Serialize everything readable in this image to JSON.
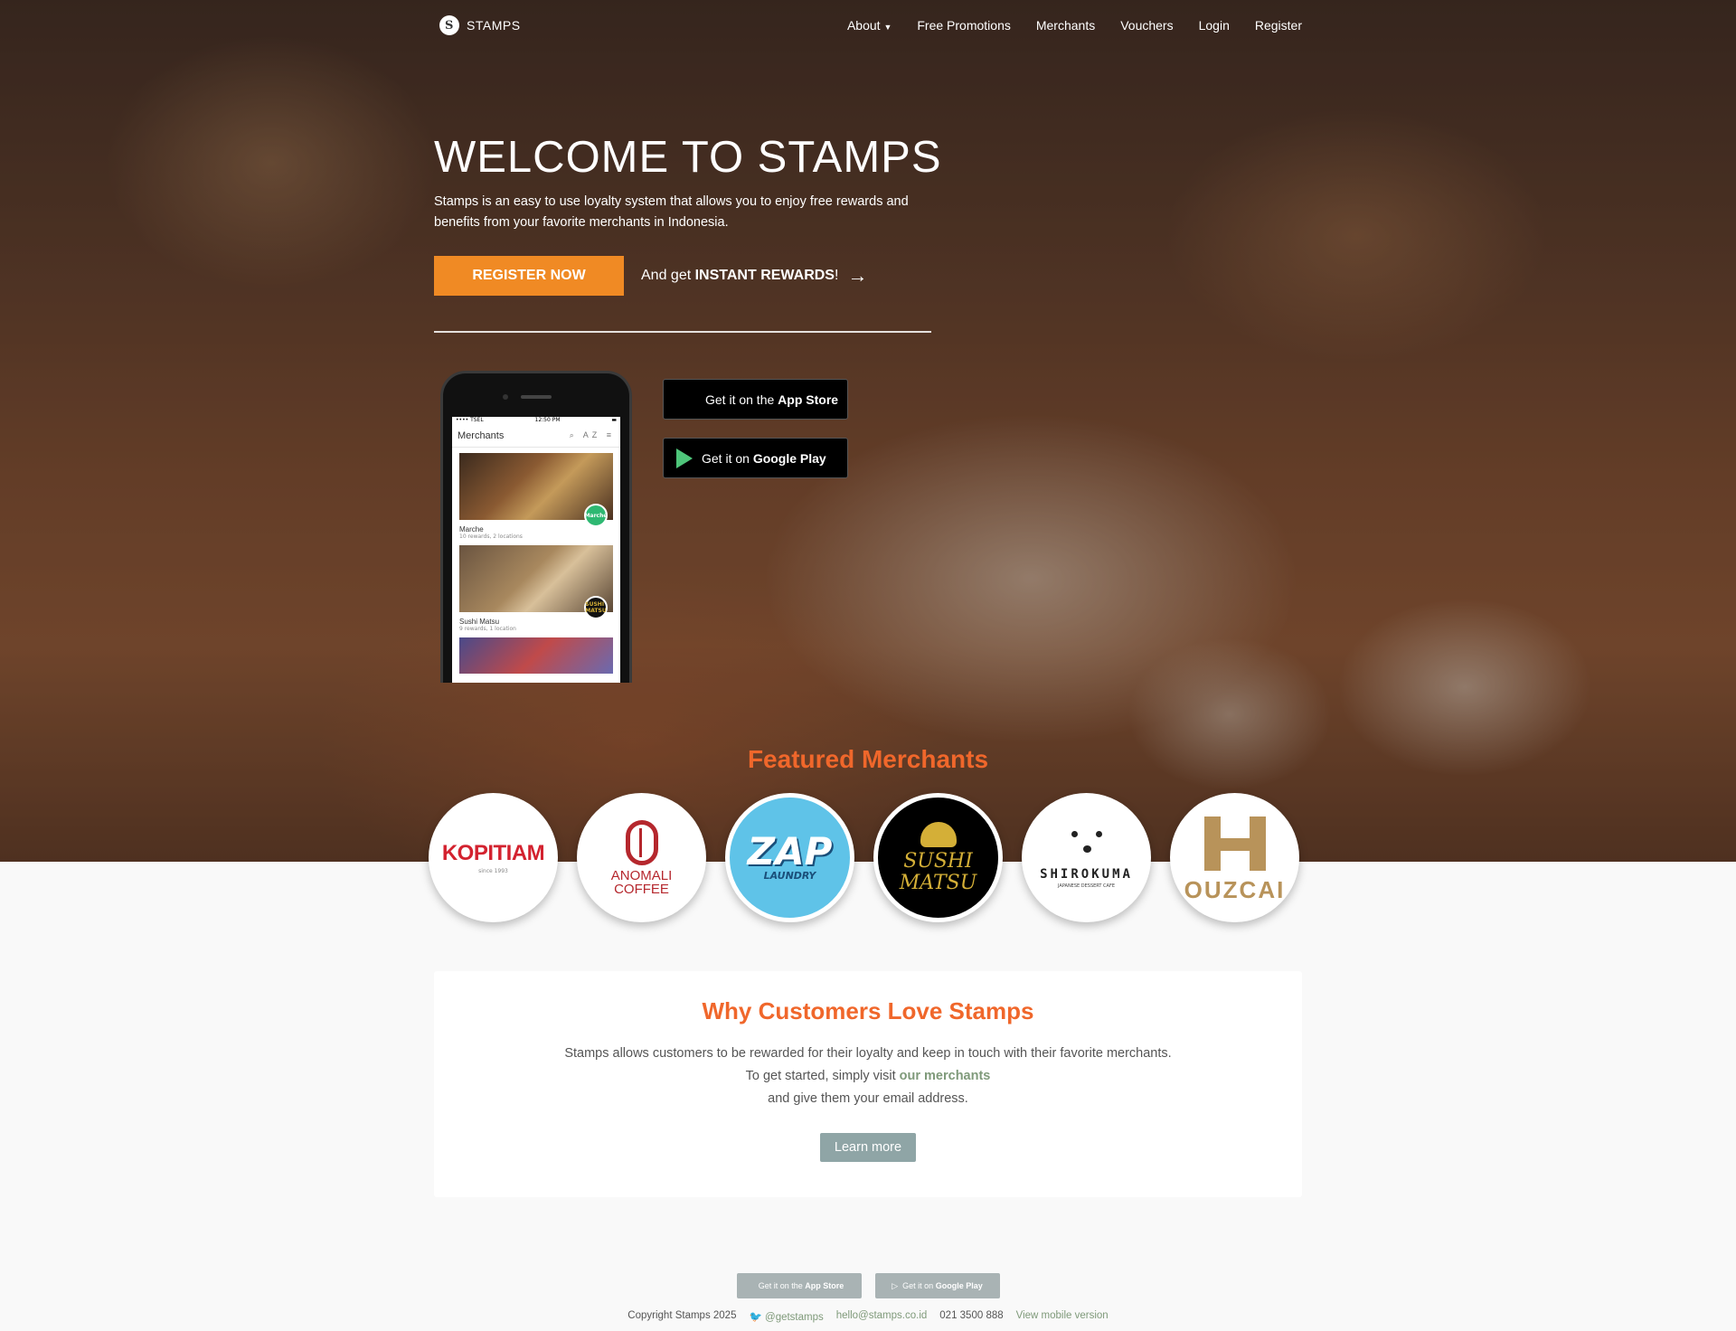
{
  "brand": {
    "name": "STAMPS",
    "logo_letter": "S"
  },
  "nav": {
    "items": [
      {
        "label": "About",
        "has_dropdown": true
      },
      {
        "label": "Free Promotions"
      },
      {
        "label": "Merchants"
      },
      {
        "label": "Vouchers"
      },
      {
        "label": "Login"
      },
      {
        "label": "Register"
      }
    ]
  },
  "hero": {
    "title": "WELCOME TO STAMPS",
    "lead": "Stamps is an easy to use loyalty system that allows you to enjoy free rewards and benefits from your favorite merchants in Indonesia.",
    "register_button": "REGISTER NOW",
    "instant_prefix": "And get",
    "instant_bold": "INSTANT REWARDS",
    "instant_suffix": "!"
  },
  "phone": {
    "status_left": "•••• TSEL",
    "status_time": "12:50 PM",
    "screen_title": "Merchants",
    "cards": [
      {
        "name": "Marche",
        "sub": "10 rewards, 2 locations",
        "badge": "Marché"
      },
      {
        "name": "Sushi Matsu",
        "sub": "9 rewards, 1 location",
        "badge": "SUSHI MATSU"
      }
    ]
  },
  "stores": {
    "app_store": {
      "prefix": "Get it on the",
      "bold": "App Store"
    },
    "google_play": {
      "prefix": "Get it on",
      "bold": "Google Play"
    }
  },
  "featured": {
    "title": "Featured Merchants",
    "merchants": [
      {
        "name": "KOPITIAM",
        "sub": "since 1993"
      },
      {
        "name": "ANOMALI",
        "line2": "COFFEE"
      },
      {
        "name": "ZAP",
        "sub": "LAUNDRY"
      },
      {
        "name": "SUSHI",
        "line2": "MATSU"
      },
      {
        "name": "SHIROKUMA",
        "sub": "JAPANESE DESSERT CAFE"
      },
      {
        "name": "OUZCAI"
      }
    ]
  },
  "why": {
    "title": "Why Customers Love Stamps",
    "line1": "Stamps allows customers to be rewarded for their loyalty and keep in touch with their favorite merchants.",
    "line2_prefix": "To get started, simply visit",
    "line2_link": "our merchants",
    "line3": "and give them your email address.",
    "button": "Learn more"
  },
  "footer": {
    "app_store": {
      "prefix": "Get it on the",
      "bold": "App Store"
    },
    "google_play": {
      "prefix": "Get it on",
      "bold": "Google Play"
    },
    "copyright": "Copyright Stamps 2025",
    "twitter": "@getstamps",
    "email": "hello@stamps.co.id",
    "phone": "021 3500 888",
    "mobile_link": "View mobile version"
  },
  "colors": {
    "accent": "#f08a24",
    "headline_orange": "#f0672b",
    "link_green": "#7f9a7a"
  }
}
